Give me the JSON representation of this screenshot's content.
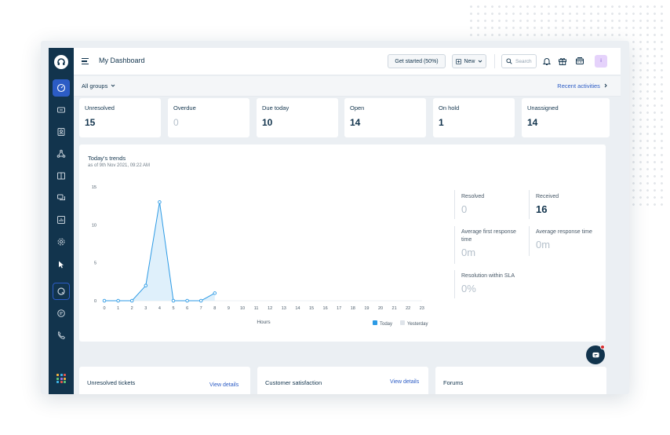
{
  "header": {
    "title": "My Dashboard",
    "get_started": "Get started (50%)",
    "new_label": "New",
    "search_placeholder": "Search",
    "avatar_initial": "i"
  },
  "subbar": {
    "group_filter": "All groups",
    "recent_activities": "Recent activities"
  },
  "stats": [
    {
      "label": "Unresolved",
      "value": "15"
    },
    {
      "label": "Overdue",
      "value": "0"
    },
    {
      "label": "Due today",
      "value": "10"
    },
    {
      "label": "Open",
      "value": "14"
    },
    {
      "label": "On hold",
      "value": "1"
    },
    {
      "label": "Unassigned",
      "value": "14"
    }
  ],
  "trends": {
    "title": "Today's trends",
    "subtitle": "as of 9th Nov 2021, 09:22 AM"
  },
  "chart_data": {
    "type": "area",
    "title": "",
    "xlabel": "Hours",
    "ylabel": "",
    "ylim": [
      0,
      15
    ],
    "y_ticks": [
      0,
      5,
      10,
      15
    ],
    "x": [
      0,
      1,
      2,
      3,
      4,
      5,
      6,
      7,
      8,
      9,
      10,
      11,
      12,
      13,
      14,
      15,
      16,
      17,
      18,
      19,
      20,
      21,
      22,
      23
    ],
    "series": [
      {
        "name": "Today",
        "color": "#2c9ae5",
        "values": [
          0,
          0,
          0,
          2,
          13,
          0,
          0,
          0,
          1
        ]
      },
      {
        "name": "Yesterday",
        "color": "#dfe4ea",
        "values": []
      }
    ],
    "legend": "bottom-right"
  },
  "metrics": {
    "resolved": {
      "label": "Resolved",
      "value": "0"
    },
    "received": {
      "label": "Received",
      "value": "16"
    },
    "avg_first_response": {
      "label": "Average first response time",
      "value": "0m"
    },
    "avg_response": {
      "label": "Average response time",
      "value": "0m"
    },
    "resolution_sla": {
      "label": "Resolution within SLA",
      "value": "0%"
    }
  },
  "bottom": [
    {
      "title": "Unresolved tickets",
      "link": "View details"
    },
    {
      "title": "Customer satisfaction",
      "link": "View details"
    },
    {
      "title": "Forums",
      "link": ""
    }
  ],
  "icons": {
    "brand_logo": "headset-logo",
    "apps": "apps-grid-icon"
  }
}
